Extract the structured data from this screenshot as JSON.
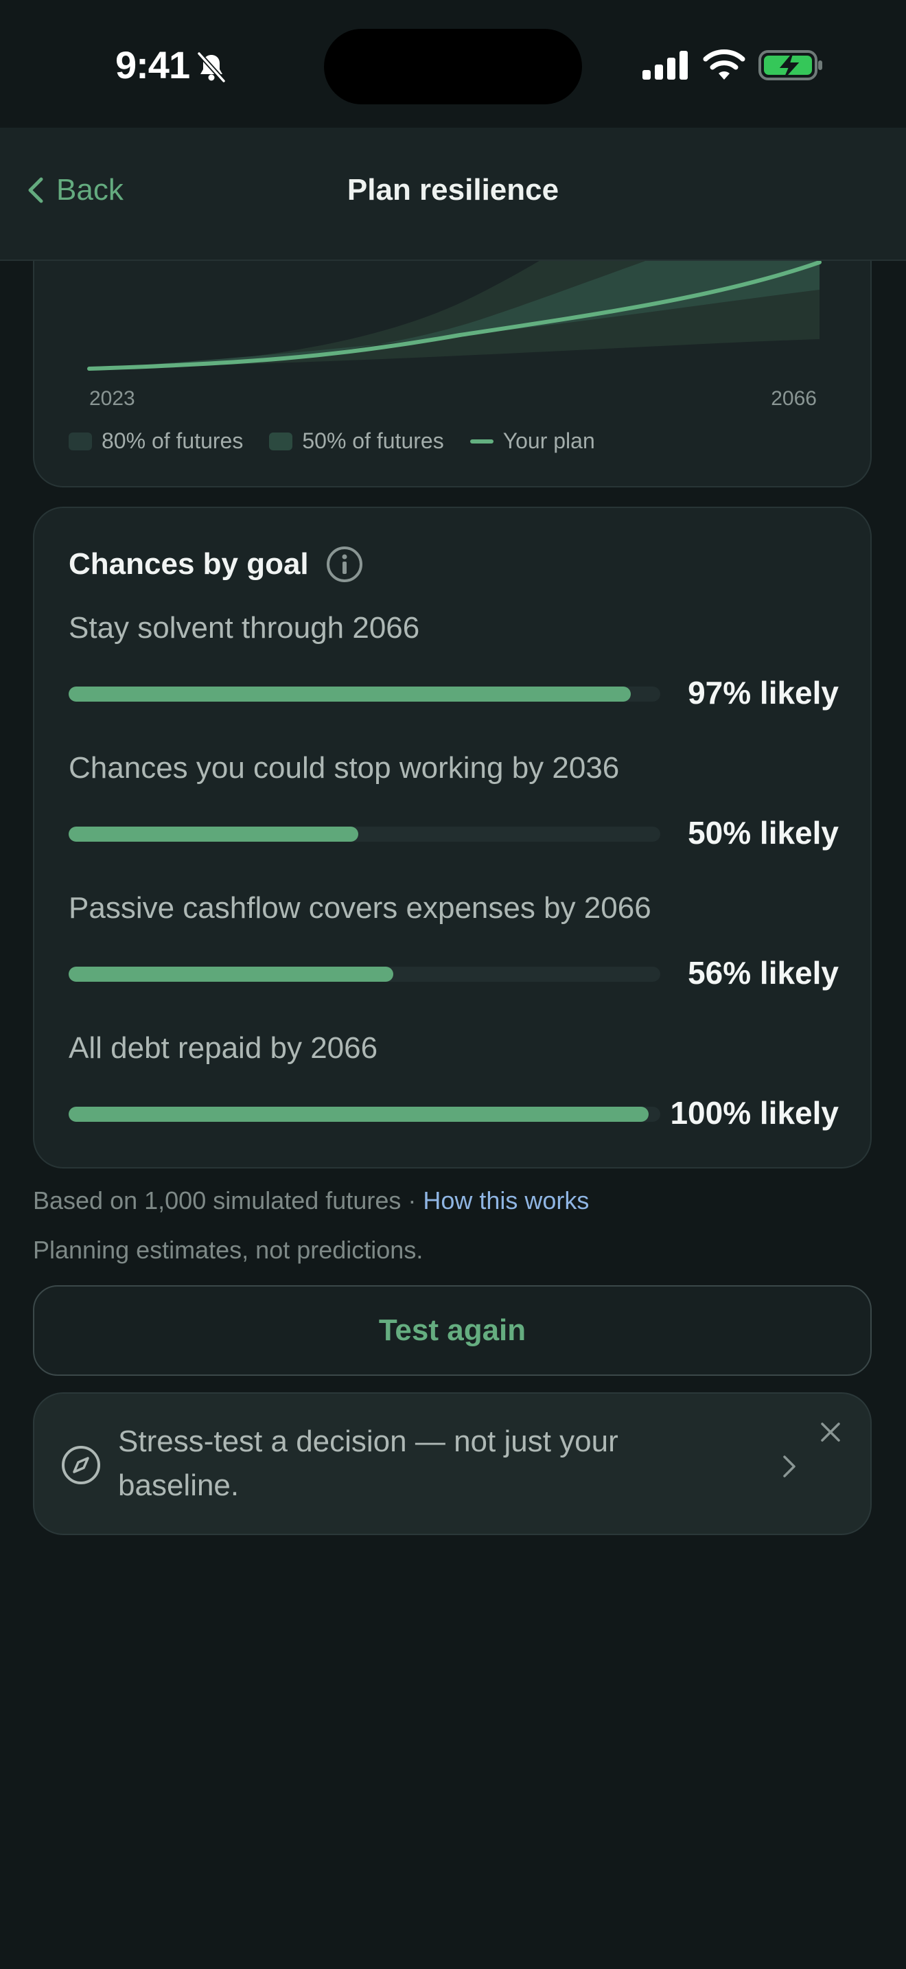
{
  "status_bar": {
    "time": "9:41"
  },
  "nav": {
    "back_label": "Back",
    "title": "Plan resilience"
  },
  "chart_data": {
    "type": "area",
    "x_start_label": "2023",
    "x_end_label": "2066",
    "legend": [
      "80% of futures",
      "50% of futures",
      "Your plan"
    ],
    "colors": {
      "band_80": "#263a37",
      "band_50": "#2c4a40",
      "plan_line": "#63b080"
    }
  },
  "goals": {
    "title": "Chances by goal",
    "items": [
      {
        "label": "Stay solvent through 2066",
        "percent": 97,
        "value_text": "97% likely"
      },
      {
        "label": "Chances you could stop working by 2036",
        "percent": 50,
        "value_text": "50% likely"
      },
      {
        "label": "Passive cashflow covers expenses by 2066",
        "percent": 56,
        "value_text": "56% likely"
      },
      {
        "label": "All debt repaid by 2066",
        "percent": 100,
        "value_text": "100% likely"
      }
    ]
  },
  "footer": {
    "based_on": "Based on 1,000 simulated futures · ",
    "how_link": "How this works",
    "disclaimer": "Planning estimates, not predictions."
  },
  "test_again": "Test again",
  "stress_banner": {
    "text": "Stress-test a decision — not just your baseline."
  },
  "colors": {
    "accent": "#64ab7f",
    "link": "#8fb5e3",
    "background": "#111819",
    "card": "#1a2425"
  }
}
